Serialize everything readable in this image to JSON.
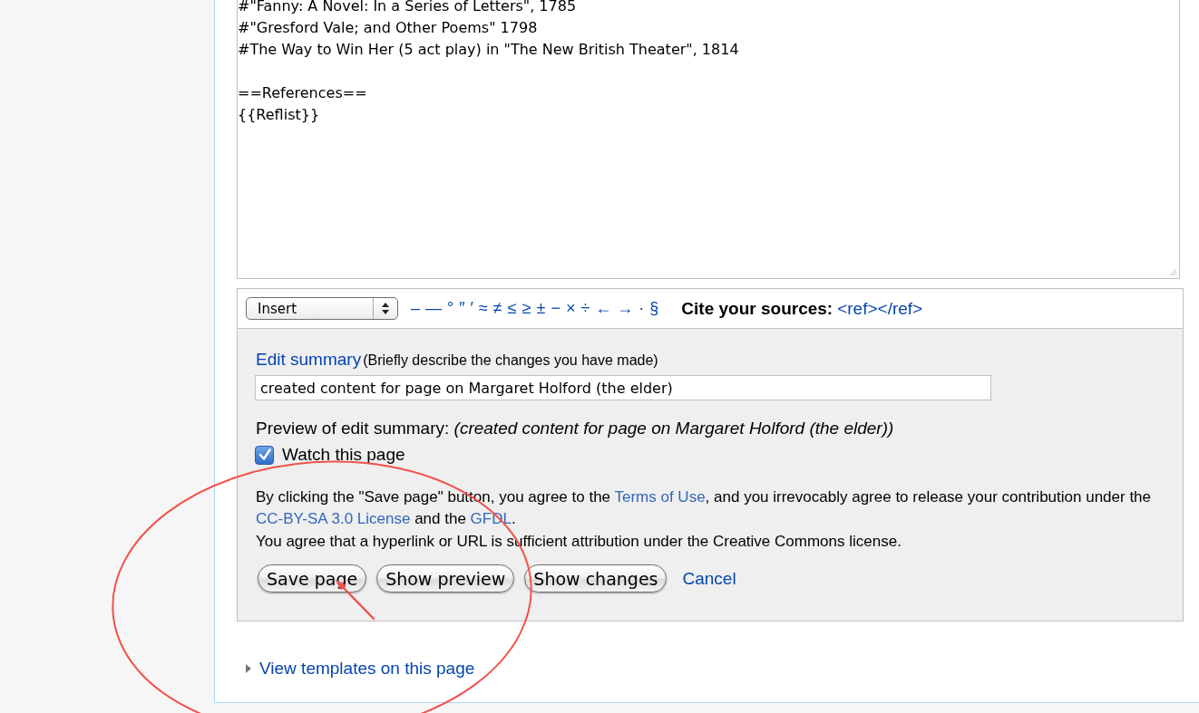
{
  "editor": {
    "paragraphs": [
      {
        "lines": [
          "#\"Fanny: A Novel: In a Series of Letters\", 1785",
          "#\"Gresford Vale; and Other Poems\" 1798",
          "#The Way to Win Her (5 act play) in \"The New British Theater\", 1814"
        ]
      },
      {
        "lines": [
          "==References==",
          "{{Reflist}}"
        ]
      }
    ]
  },
  "toolbar": {
    "insert_select": {
      "value": "Insert"
    },
    "special_characters": [
      "–",
      "—",
      "°",
      "″",
      "′",
      "≈",
      "≠",
      "≤",
      "≥",
      "±",
      "−",
      "×",
      "÷",
      "←",
      "→",
      "·",
      "§"
    ],
    "cite_label": "Cite your sources:",
    "cite_link": "<ref></ref>"
  },
  "summary": {
    "label_link": "Edit summary",
    "hint": "(Briefly describe the changes you have made)",
    "value": "created content for page on Margaret Holford (the elder)",
    "preview": "Preview of edit summary: *(created content for page on Margaret Holford (the elder))*"
  },
  "watch": {
    "label": "Watch this page",
    "checked": true
  },
  "license": [
    {
      "segments": [
        {
          "kind": "text",
          "text": "By clicking the \"Save page\" button, you agree to the "
        },
        {
          "kind": "link",
          "text": "Terms of Use"
        },
        {
          "kind": "text",
          "text": ", and you irrevocably agree to release your contribution under the "
        },
        {
          "kind": "link",
          "text": "CC-BY-SA 3.0 License"
        },
        {
          "kind": "text",
          "text": " and the "
        },
        {
          "kind": "link",
          "text": "GFDL"
        },
        {
          "kind": "text",
          "text": "."
        }
      ]
    },
    {
      "segments": [
        {
          "kind": "text",
          "text": "You agree that a hyperlink or URL is sufficient attribution under the Creative Commons license."
        }
      ]
    }
  ],
  "buttons": [
    {
      "kind": "button",
      "label": "Save page"
    },
    {
      "kind": "button",
      "label": "Show preview"
    },
    {
      "kind": "button",
      "label": "Show changes"
    },
    {
      "kind": "link",
      "label": "Cancel"
    }
  ],
  "templates_toggle": {
    "label": "View templates on this page",
    "expanded": false
  },
  "annotation": {
    "kind": "ellipse-with-arrow"
  }
}
